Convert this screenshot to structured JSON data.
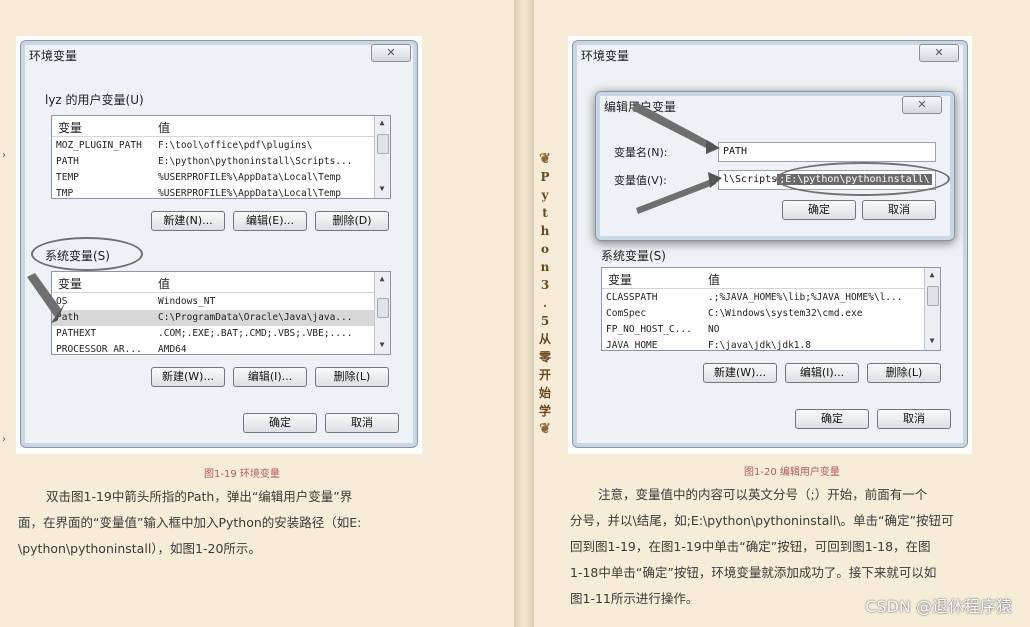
{
  "spine": {
    "text": "Python 3.5从零开始学"
  },
  "fig1": {
    "window_title": "环境变量",
    "user_group_title": "lyz 的用户变量(U)",
    "col_var": "变量",
    "col_val": "值",
    "user_rows": [
      {
        "name": "MOZ_PLUGIN_PATH",
        "value": "F:\\tool\\office\\pdf\\plugins\\"
      },
      {
        "name": "PATH",
        "value": "E:\\python\\pythoninstall\\Scripts..."
      },
      {
        "name": "TEMP",
        "value": "%USERPROFILE%\\AppData\\Local\\Temp"
      },
      {
        "name": "TMP",
        "value": "%USERPROFILE%\\AppData\\Local\\Temp"
      }
    ],
    "user_buttons": {
      "new": "新建(N)...",
      "edit": "编辑(E)...",
      "delete": "删除(D)"
    },
    "sys_group_title": "系统变量(S)",
    "sys_rows": [
      {
        "name": "OS",
        "value": "Windows_NT"
      },
      {
        "name": "Path",
        "value": "C:\\ProgramData\\Oracle\\Java\\java..."
      },
      {
        "name": "PATHEXT",
        "value": ".COM;.EXE;.BAT;.CMD;.VBS;.VBE;...."
      },
      {
        "name": "PROCESSOR_AR...",
        "value": "AMD64"
      }
    ],
    "sys_buttons": {
      "new": "新建(W)...",
      "edit": "编辑(I)...",
      "delete": "删除(L)"
    },
    "ok": "确定",
    "cancel": "取消",
    "close": "✕"
  },
  "fig1_caption": "图1-19 环境变量",
  "left_para": [
    "双击图1-19中箭头所指的Path，弹出“编辑用户变量”界",
    "面，在界面的“变量值”输入框中加入Python的安装路径（如E:",
    "\\python\\pythoninstall），如图1-20所示。"
  ],
  "fig2": {
    "window_title": "环境变量",
    "close": "✕",
    "dialog_title": "编辑用户变量",
    "dialog_close": "✕",
    "name_label": "变量名(N):",
    "name_value": "PATH",
    "value_label": "变量值(V):",
    "value_prefix": "l\\Scripts",
    "value_highlight": ";E:\\python\\pythoninstall\\",
    "dialog_ok": "确定",
    "dialog_cancel": "取消",
    "sys_group_title": "系统变量(S)",
    "col_var": "变量",
    "col_val": "值",
    "sys_rows": [
      {
        "name": "CLASSPATH",
        "value": ".;%JAVA_HOME%\\lib;%JAVA_HOME%\\l..."
      },
      {
        "name": "ComSpec",
        "value": "C:\\Windows\\system32\\cmd.exe"
      },
      {
        "name": "FP_NO_HOST_C...",
        "value": "NO"
      },
      {
        "name": "JAVA_HOME",
        "value": "F:\\java\\jdk\\jdk1.8"
      }
    ],
    "sys_buttons": {
      "new": "新建(W)...",
      "edit": "编辑(I)...",
      "delete": "删除(L)"
    },
    "ok": "确定",
    "cancel": "取消"
  },
  "fig2_caption": "图1-20 编辑用户变量",
  "right_para": [
    "注意，变量值中的内容可以英文分号（;）开始，前面有一个",
    "分号，并以\\结尾，如;E:\\python\\pythoninstall\\。单击“确定”按钮可",
    "回到图1-19，在图1-19中单击“确定”按钮，可回到图1-18，在图",
    "1-18中单击“确定”按钮，环境变量就添加成功了。接下来就可以如",
    "图1-11所示进行操作。"
  ],
  "watermark": "CSDN @退休程序猿"
}
